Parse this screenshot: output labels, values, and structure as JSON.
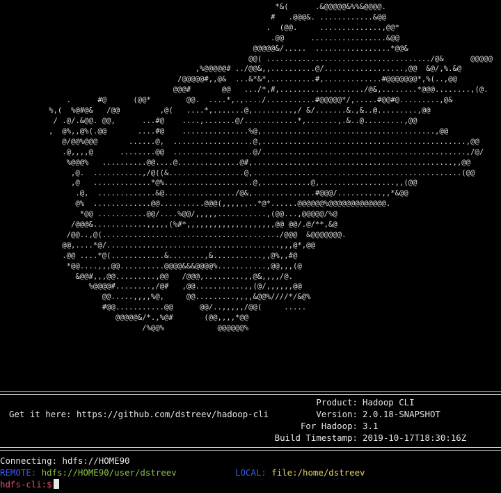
{
  "ascii_art": [
    "                                                              *&(      .&@@@@@&%%&@@@@.",
    "                                                             #   .@@@&. ............&@@",
    "                                                            .  (@@.     ..............,@@*",
    "                                                             .@@      .................&@@",
    "                                                         @@@@@&/.....  .................*@@&",
    "                                                        @@( ...................................../@&      @@@@@",
    "                                            ,%@@@@@# ../@@&,,..........@/..................,@@  &@/,%.&@",
    "                                        /@@@@@#,,@&  ...&*&*,..........#,.............#@@@@@@@*,%(..,@@",
    "                                       @@@#       @@   .../*,#,.................../@&,........*@@@........,(@.",
    "               .      #@      (@@*        @@.  ....*,.,..../...........#@@@@@*/,.....#@@#@.........,@&",
    "           %,(  %@#@&   /@@         ,@(   ....*,.......@,.........,/ &/.......&.,&..@.........,@@",
    "            / .@/.&@@. @@,      ...#@    ....,.......@/............*,.......,.&..@.........,@@",
    "           ,  @%,,@%(.@@       ....#@    ...............%@,.......................................,@@",
    "              @/@@%@@@       ......@,  ..................@,..............................................,@@",
    "              .@,,,,@      ........@@  ..................@/..............................................,/@/",
    "               %@@@%   ..........@@....@..............@#,.............................................,,@@",
    "                ,@.  ...........,/@((&.................@,...............................................(@@",
    "                ,@   .............*@%....................@,...........@,.................,,(@@",
    "                 .@,  .............&@................/@&,..............#@@@/..........,,*&@@",
    "                 @%  .............@@..........@@@(,,,,,,..*@*......@@@@@@%@@@@@@@@@@@@@.",
    "                  *@@ ...........@@/....%@@/,,,,,...........,(@@...,@@@@@/%@",
    "                /@@@&............,,,,,(%#*,,,,,,,,,,,,,,,,,,,,@@ @@/.@/**,&@",
    "               /@@..,@(......................................../@@@  &@@@@@@@.",
    "              @@,....*@/.......................................,,,@*,@@",
    "              .@@ ....*@(............&........,&...........,,@%,,#@",
    "               *@@....,,,@@..........@@@@&&&@@@@%...........,@@,,,(@",
    "                 &@@#,,,@@.........,@@   /@@@,.........,,@&,,,,/@.",
    "                    %@@@@#........,/@#   ,@@...........,,(@/,,,,,,@@",
    "                       @@.....,,,,%@,     @@.........,,,,&@@%////*/&@%",
    "                       #@@...........@@      @@/..,,,,,/@@(     .....",
    "                          @@@@@&/*.,%@#       (@@,,,,*@@",
    "                                /%@@%            @@@@@@%"
  ],
  "banner": {
    "get_it_here": "Get it here: https://github.com/dstreev/hadoop-cli",
    "fields": [
      {
        "key": "Product:",
        "value": "Hadoop CLI"
      },
      {
        "key": "Version:",
        "value": "2.0.18-SNAPSHOT"
      },
      {
        "key": "For Hadoop:",
        "value": "3.1"
      },
      {
        "key": "Build Timestamp:",
        "value": "2019-10-17T18:30:16Z"
      }
    ]
  },
  "session": {
    "connecting": "Connecting: hdfs://HOME90",
    "remote_label": "REMOTE:",
    "remote_value": "hdfs://HOME90/user/dstreev",
    "local_label": "LOCAL:",
    "local_value": "file:/home/dstreev",
    "prompt": "hdfs-cli:$"
  },
  "colors": {
    "background": "#000000",
    "foreground": "#e6e6e6",
    "remote_label": "#3a5cf0",
    "remote_value": "#8bc34a",
    "local_label": "#3a5cf0",
    "local_value": "#e2d36a",
    "prompt": "#e0566b"
  }
}
